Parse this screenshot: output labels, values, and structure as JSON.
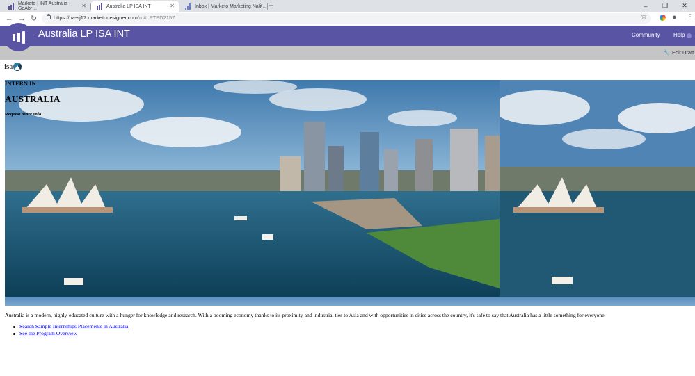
{
  "browser": {
    "tabs": [
      {
        "title": "Marketo | INT Australia - GoAbr…",
        "active": false
      },
      {
        "title": "Australia LP ISA INT",
        "active": true
      },
      {
        "title": "Inbox | Marketo Marketing Nati…",
        "active": false
      }
    ],
    "new_tab": "+",
    "controls": {
      "minimize": "–",
      "restore": "❐",
      "close": "✕"
    },
    "nav": {
      "back": "←",
      "forward": "→",
      "reload": "↻"
    },
    "url_host": "https://na-sj17.marketodesigner.com",
    "url_path": "/m#LPTPD2157",
    "star": "☆",
    "profile": "●",
    "menu": "⋮"
  },
  "marketo": {
    "title": "Australia LP ISA INT",
    "community": "Community",
    "help": "Help",
    "edit_draft": "Edit Draft",
    "brand_color": "#5a54a4"
  },
  "page": {
    "logo_text": "isa",
    "hero": {
      "kicker": "INTERN IN",
      "heading": "AUSTRALIA",
      "cta": "Request More Info"
    },
    "body": "Australia is a modern, highly-educated culture with a hunger for knowledge and research. With a booming economy thanks to its proximity and industrial ties to Asia and with opportunities in cities across the country, it's safe to say that Australia has a little something for everyone.",
    "links": [
      "Search Sample Internships Placements in Australia",
      "See the Program Overview"
    ]
  }
}
